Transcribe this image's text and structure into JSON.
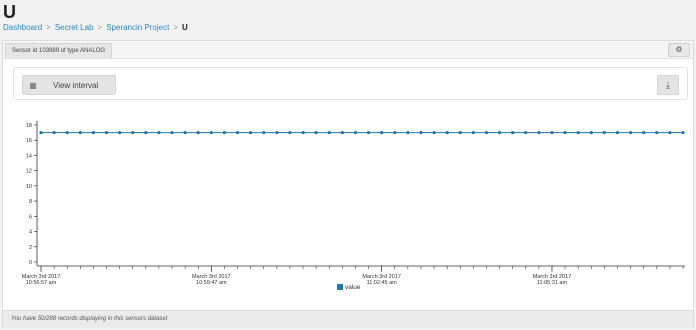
{
  "page": {
    "title": "U"
  },
  "breadcrumb": [
    {
      "label": "Dashboard"
    },
    {
      "label": "Secret Lab"
    },
    {
      "label": "Sperancin Project"
    },
    {
      "label": "U"
    }
  ],
  "panel": {
    "sensor_label": "Sensor id 103989 of type ANALOG",
    "settings_icon": "gears-icon"
  },
  "toolbar": {
    "view_interval_label": "View interval",
    "calendar_icon": "calendar-icon",
    "download_icon": "download-icon"
  },
  "footer": {
    "text": "You have 50/288 records displaying in this sensors dataset"
  },
  "chart_data": {
    "type": "line",
    "ylim": [
      0,
      18
    ],
    "yticks": [
      0,
      2,
      4,
      6,
      8,
      10,
      12,
      14,
      16,
      18
    ],
    "series": [
      {
        "name": "value",
        "color": "#1f77b4",
        "values": [
          17,
          17,
          17,
          17,
          17,
          17,
          17,
          17,
          17,
          17,
          17,
          17,
          17,
          17,
          17,
          17,
          17,
          17,
          17,
          17,
          17,
          17,
          17,
          17,
          17,
          17,
          17,
          17,
          17,
          17,
          17,
          17,
          17,
          17,
          17,
          17,
          17,
          17,
          17,
          17,
          17,
          17,
          17,
          17,
          17,
          17,
          17,
          17,
          17,
          17
        ]
      }
    ],
    "xticks": [
      {
        "line1": "March 3rd 2017",
        "line2": "10:56:57 am",
        "index": 0
      },
      {
        "line1": "March 3rd 2017",
        "line2": "10:59:47 am",
        "index": 13
      },
      {
        "line1": "March 3rd 2017",
        "line2": "11:02:45 am",
        "index": 26
      },
      {
        "line1": "March 3rd 2017",
        "line2": "11:05:31 am",
        "index": 39
      }
    ],
    "legend": "bottom-center",
    "grid": false
  }
}
